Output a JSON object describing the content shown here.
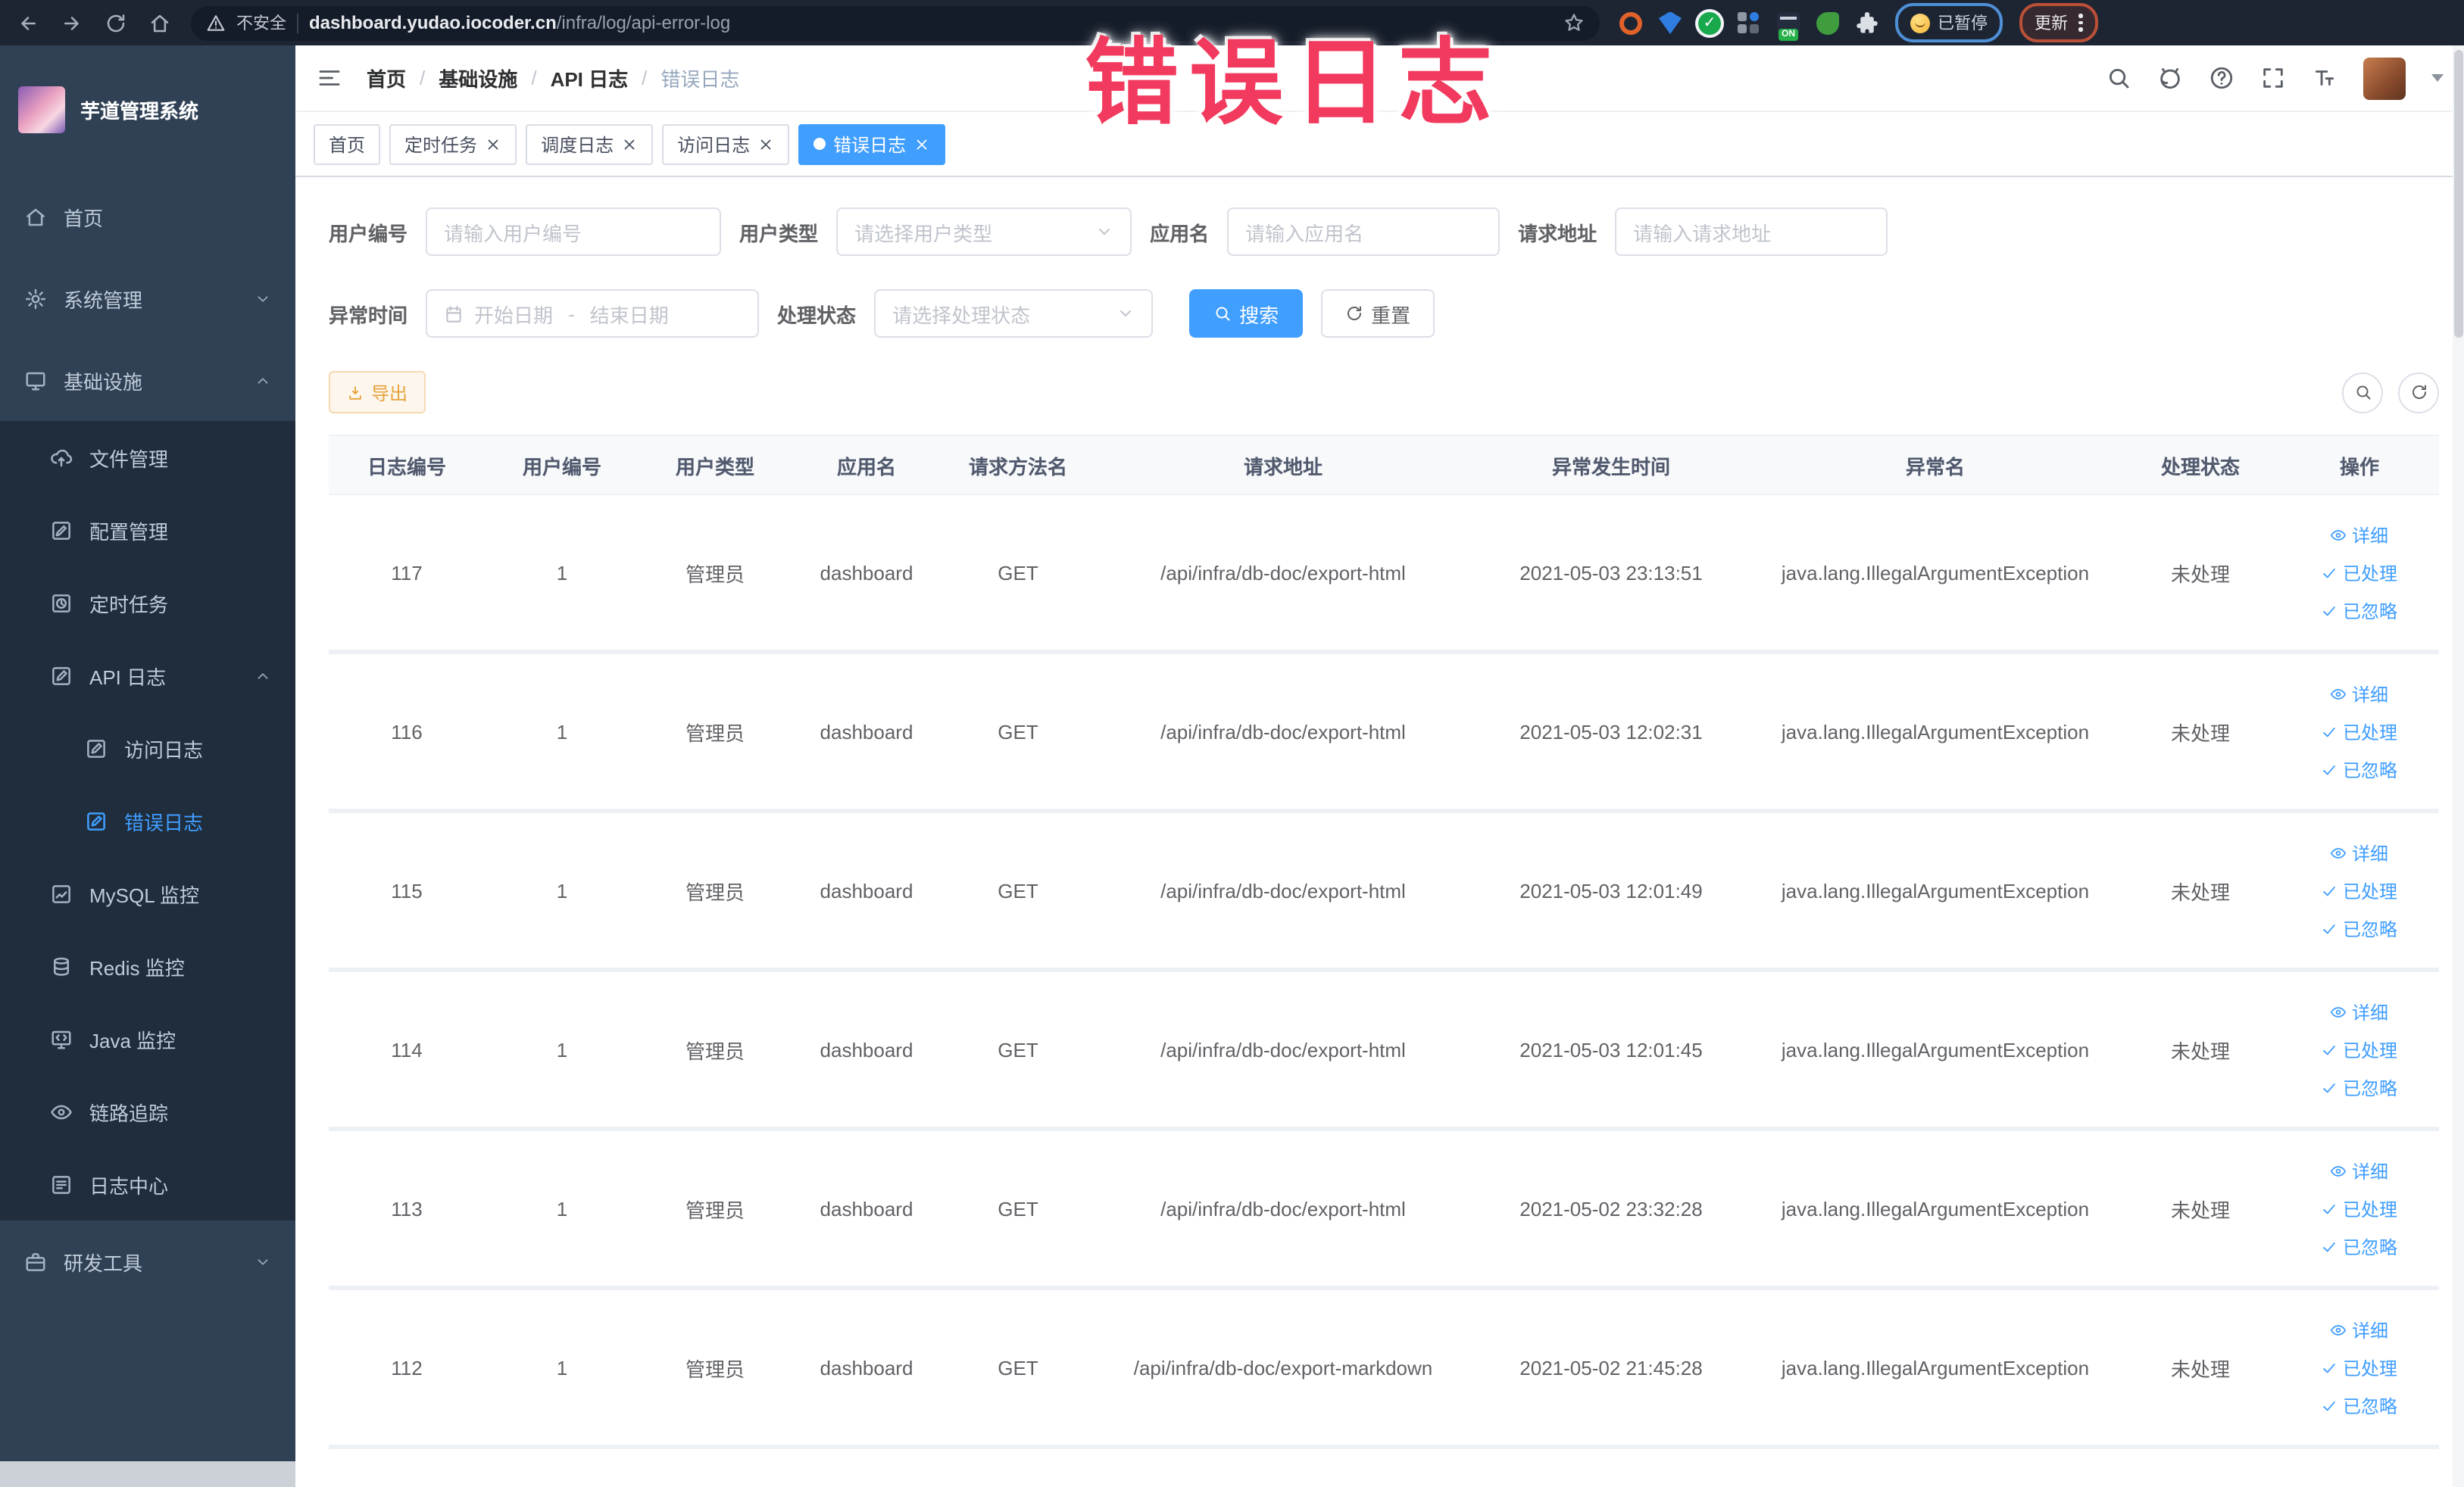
{
  "browser": {
    "security_label": "不安全",
    "url_host": "dashboard.yudao.iocoder.cn",
    "url_path": "/infra/log/api-error-log",
    "paused_badge": "已暂停",
    "update_button": "更新"
  },
  "annotation": "错误日志",
  "sidebar": {
    "title": "芋道管理系统",
    "items": [
      {
        "label": "首页",
        "icon": "home",
        "indent": 0,
        "sub": false
      },
      {
        "label": "系统管理",
        "icon": "gear",
        "indent": 0,
        "sub": false,
        "arrow": "down"
      },
      {
        "label": "基础设施",
        "icon": "infra",
        "indent": 0,
        "sub": false,
        "arrow": "up"
      },
      {
        "label": "文件管理",
        "icon": "file",
        "indent": 1,
        "sub": true
      },
      {
        "label": "配置管理",
        "icon": "config",
        "indent": 1,
        "sub": true
      },
      {
        "label": "定时任务",
        "icon": "job",
        "indent": 1,
        "sub": true
      },
      {
        "label": "API 日志",
        "icon": "log",
        "indent": 1,
        "sub": true,
        "arrow": "up"
      },
      {
        "label": "访问日志",
        "icon": "log",
        "indent": 2,
        "sub": true
      },
      {
        "label": "错误日志",
        "icon": "log",
        "indent": 2,
        "sub": true,
        "active": true
      },
      {
        "label": "MySQL 监控",
        "icon": "mysql",
        "indent": 1,
        "sub": true
      },
      {
        "label": "Redis 监控",
        "icon": "redis",
        "indent": 1,
        "sub": true
      },
      {
        "label": "Java 监控",
        "icon": "java",
        "indent": 1,
        "sub": true
      },
      {
        "label": "链路追踪",
        "icon": "trace",
        "indent": 1,
        "sub": true
      },
      {
        "label": "日志中心",
        "icon": "logcenter",
        "indent": 1,
        "sub": true
      },
      {
        "label": "研发工具",
        "icon": "tools",
        "indent": 0,
        "sub": false,
        "arrow": "down"
      }
    ]
  },
  "breadcrumb": [
    "首页",
    "基础设施",
    "API 日志",
    "错误日志"
  ],
  "tabs": [
    {
      "label": "首页",
      "closable": false,
      "active": false
    },
    {
      "label": "定时任务",
      "closable": true,
      "active": false
    },
    {
      "label": "调度日志",
      "closable": true,
      "active": false
    },
    {
      "label": "访问日志",
      "closable": true,
      "active": false
    },
    {
      "label": "错误日志",
      "closable": true,
      "active": true
    }
  ],
  "filters": {
    "user_id": {
      "label": "用户编号",
      "placeholder": "请输入用户编号"
    },
    "user_type": {
      "label": "用户类型",
      "placeholder": "请选择用户类型"
    },
    "app_name": {
      "label": "应用名",
      "placeholder": "请输入应用名"
    },
    "request_url": {
      "label": "请求地址",
      "placeholder": "请输入请求地址"
    },
    "exception_time": {
      "label": "异常时间",
      "start_placeholder": "开始日期",
      "separator": "-",
      "end_placeholder": "结束日期"
    },
    "process_status": {
      "label": "处理状态",
      "placeholder": "请选择处理状态"
    },
    "search_label": "搜索",
    "reset_label": "重置"
  },
  "toolbar": {
    "export_label": "导出"
  },
  "actions": {
    "detail": "详细",
    "processed": "已处理",
    "ignored": "已忽略"
  },
  "table": {
    "columns": [
      "日志编号",
      "用户编号",
      "用户类型",
      "应用名",
      "请求方法名",
      "请求地址",
      "异常发生时间",
      "异常名",
      "处理状态",
      "操作"
    ],
    "rows": [
      {
        "id": "117",
        "user_id": "1",
        "user_type": "管理员",
        "app": "dashboard",
        "method": "GET",
        "url": "/api/infra/db-doc/export-html",
        "time": "2021-05-03 23:13:51",
        "exception": "java.lang.IllegalArgumentException",
        "status": "未处理"
      },
      {
        "id": "116",
        "user_id": "1",
        "user_type": "管理员",
        "app": "dashboard",
        "method": "GET",
        "url": "/api/infra/db-doc/export-html",
        "time": "2021-05-03 12:02:31",
        "exception": "java.lang.IllegalArgumentException",
        "status": "未处理"
      },
      {
        "id": "115",
        "user_id": "1",
        "user_type": "管理员",
        "app": "dashboard",
        "method": "GET",
        "url": "/api/infra/db-doc/export-html",
        "time": "2021-05-03 12:01:49",
        "exception": "java.lang.IllegalArgumentException",
        "status": "未处理"
      },
      {
        "id": "114",
        "user_id": "1",
        "user_type": "管理员",
        "app": "dashboard",
        "method": "GET",
        "url": "/api/infra/db-doc/export-html",
        "time": "2021-05-03 12:01:45",
        "exception": "java.lang.IllegalArgumentException",
        "status": "未处理"
      },
      {
        "id": "113",
        "user_id": "1",
        "user_type": "管理员",
        "app": "dashboard",
        "method": "GET",
        "url": "/api/infra/db-doc/export-html",
        "time": "2021-05-02 23:32:28",
        "exception": "java.lang.IllegalArgumentException",
        "status": "未处理"
      },
      {
        "id": "112",
        "user_id": "1",
        "user_type": "管理员",
        "app": "dashboard",
        "method": "GET",
        "url": "/api/infra/db-doc/export-markdown",
        "time": "2021-05-02 21:45:28",
        "exception": "java.lang.IllegalArgumentException",
        "status": "未处理"
      }
    ]
  }
}
